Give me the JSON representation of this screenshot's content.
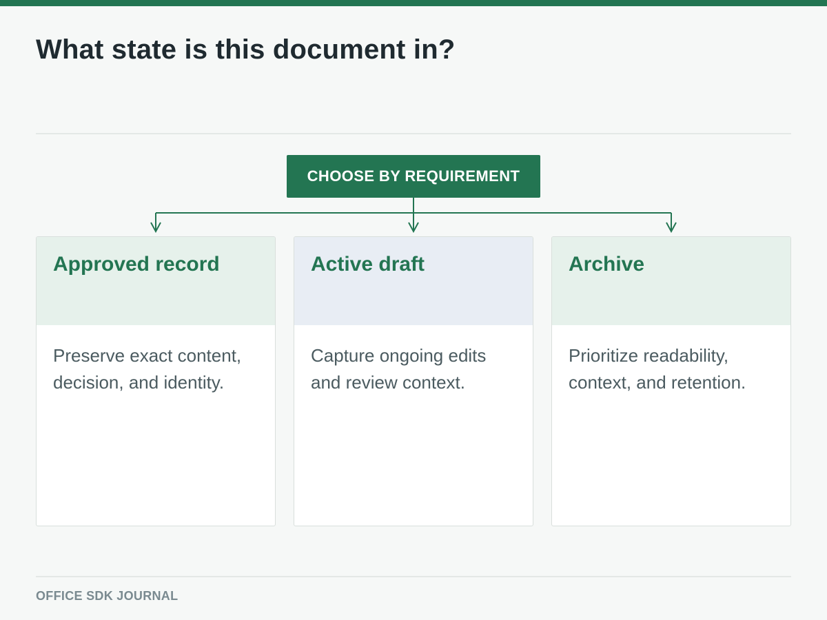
{
  "page": {
    "title": "What state is this document in?",
    "footer": "OFFICE SDK JOURNAL"
  },
  "diagram": {
    "root_label": "CHOOSE BY REQUIREMENT",
    "branches": [
      {
        "title": "Approved record",
        "body": "Preserve exact content, decision, and identity."
      },
      {
        "title": "Active draft",
        "body": "Capture ongoing edits and review context."
      },
      {
        "title": "Archive",
        "body": "Prioritize readability, context, and retention."
      }
    ]
  },
  "colors": {
    "accent": "#237552",
    "card_header_green": "#e6f1eb",
    "card_header_blue": "#e8edf4",
    "title_text": "#1f2a30",
    "body_text": "#4b5b60",
    "footer_text": "#7a8a90"
  }
}
